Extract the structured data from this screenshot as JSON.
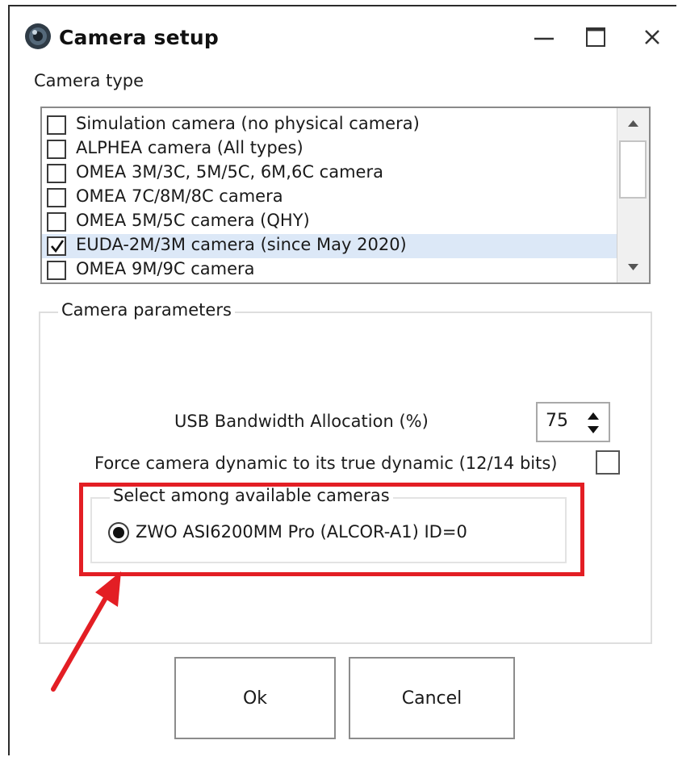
{
  "window": {
    "title": "Camera setup",
    "icon": "camera-lens-icon"
  },
  "camera_type": {
    "label": "Camera type",
    "items": [
      {
        "label": "Simulation camera (no physical camera)",
        "checked": false
      },
      {
        "label": "ALPHEA camera (All types)",
        "checked": false
      },
      {
        "label": "OMEA 3M/3C, 5M/5C, 6M,6C camera",
        "checked": false
      },
      {
        "label": "OMEA 7C/8M/8C camera",
        "checked": false
      },
      {
        "label": "OMEA 5M/5C camera (QHY)",
        "checked": false
      },
      {
        "label": "EUDA-2M/3M camera (since May 2020)",
        "checked": true
      },
      {
        "label": "OMEA 9M/9C camera",
        "checked": false
      }
    ]
  },
  "camera_parameters": {
    "legend": "Camera parameters",
    "usb_label": "USB Bandwidth Allocation (%)",
    "usb_value": "75",
    "force_label": "Force camera dynamic to its true dynamic (12/14 bits)",
    "force_checked": false,
    "select_cameras": {
      "legend": "Select among available cameras",
      "option": "ZWO ASI6200MM Pro  (ALCOR-A1)   ID=0",
      "selected": true
    }
  },
  "buttons": {
    "ok": "Ok",
    "cancel": "Cancel"
  },
  "colors": {
    "annotation": "#e31e24",
    "selection": "#dce8f7"
  }
}
